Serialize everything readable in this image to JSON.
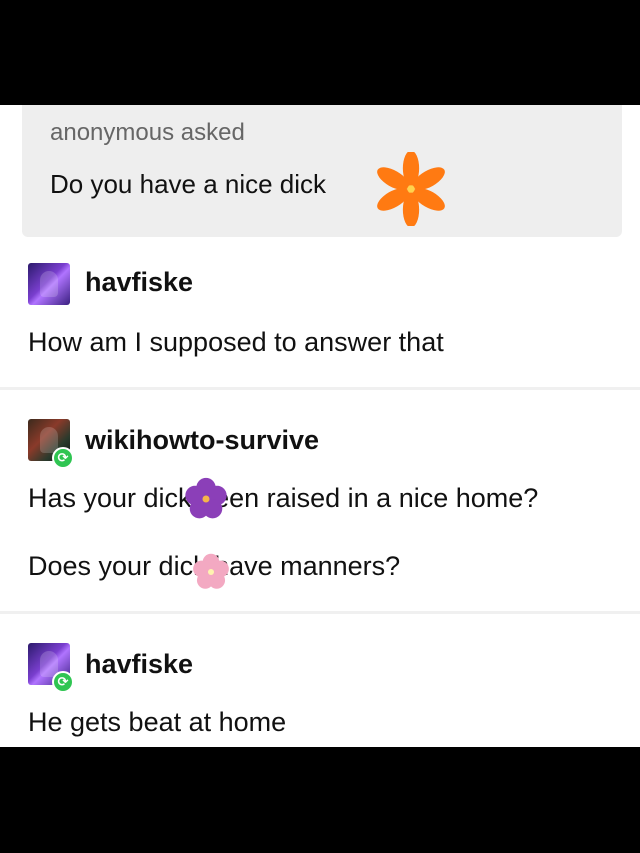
{
  "ask": {
    "asker": "anonymous asked",
    "question": "Do you have a nice dick"
  },
  "posts": [
    {
      "username": "havfiske",
      "lines": [
        "How am I supposed to answer that"
      ],
      "reblog": false
    },
    {
      "username": "wikihowto-survive",
      "lines": [
        "Has your dick been raised in a nice home?",
        "Does your dick have manners?"
      ],
      "reblog": true
    },
    {
      "username": "havfiske",
      "lines": [
        "He gets beat at home"
      ],
      "reblog": true
    }
  ],
  "stickers": {
    "orange": "orange-flower-sticker",
    "purple": "purple-flower-sticker",
    "pink": "pink-flower-sticker"
  },
  "colors": {
    "ask_bg": "#eeeeee",
    "reblog_green": "#2fc552",
    "orange_flower": "#ff7a12",
    "purple_flower": "#8b3fb8",
    "pink_flower": "#f3a9c2"
  }
}
